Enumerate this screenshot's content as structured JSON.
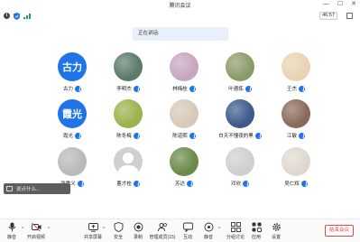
{
  "window": {
    "title": "腾讯会议"
  },
  "status": {
    "timer": "46:57"
  },
  "speaking": {
    "text": "正在讲话:"
  },
  "participants": [
    {
      "name": "古力",
      "avatar_text": "古力",
      "avatar_type": "text"
    },
    {
      "name": "李明杰",
      "avatar_type": "photo",
      "avatar_color": "#5a7a6a"
    },
    {
      "name": "林梅桂",
      "avatar_type": "photo",
      "avatar_color": "#c7a6c0"
    },
    {
      "name": "叶德炼",
      "avatar_type": "photo",
      "avatar_color": "#8c9a6a"
    },
    {
      "name": "王杰",
      "avatar_type": "photo",
      "avatar_color": "#e9d3b2"
    },
    {
      "name": "霞光",
      "avatar_text": "霞光",
      "avatar_type": "text"
    },
    {
      "name": "陈冬梅",
      "avatar_type": "photo",
      "avatar_color": "#9bb34a"
    },
    {
      "name": "陈道熙",
      "avatar_type": "photo",
      "avatar_color": "#d8c8b8"
    },
    {
      "name": "白天不懂夜的黑",
      "avatar_type": "photo",
      "avatar_color": "#3d5a8a"
    },
    {
      "name": "江敏",
      "avatar_type": "photo",
      "avatar_color": "#8a6a5a"
    },
    {
      "name": "张重义",
      "avatar_type": "photo",
      "avatar_color": "#b9b9b9"
    },
    {
      "name": "董才桂",
      "avatar_type": "placeholder",
      "avatar_color": "#d0d0d0"
    },
    {
      "name": "苏达",
      "avatar_type": "photo",
      "avatar_color": "#6a8a4a"
    },
    {
      "name": "邓欣",
      "avatar_type": "photo",
      "avatar_color": "#cfcfcf"
    },
    {
      "name": "吴仁辉",
      "avatar_type": "photo",
      "avatar_color": "#e0d8d0"
    }
  ],
  "chat": {
    "placeholder": "说点什么..."
  },
  "toolbar": {
    "mute": "静音",
    "video": "开启视频",
    "share": "共享屏幕",
    "security": "安全",
    "record": "录制",
    "members": "管理成员(15)",
    "interact": "互动",
    "apps": "静音",
    "breakout": "分组讨论",
    "app": "应用",
    "settings": "设置",
    "end": "结束会议"
  },
  "colors": {
    "accent": "#1e74e8",
    "danger": "#e34b4b",
    "signal": "#22a05a"
  }
}
